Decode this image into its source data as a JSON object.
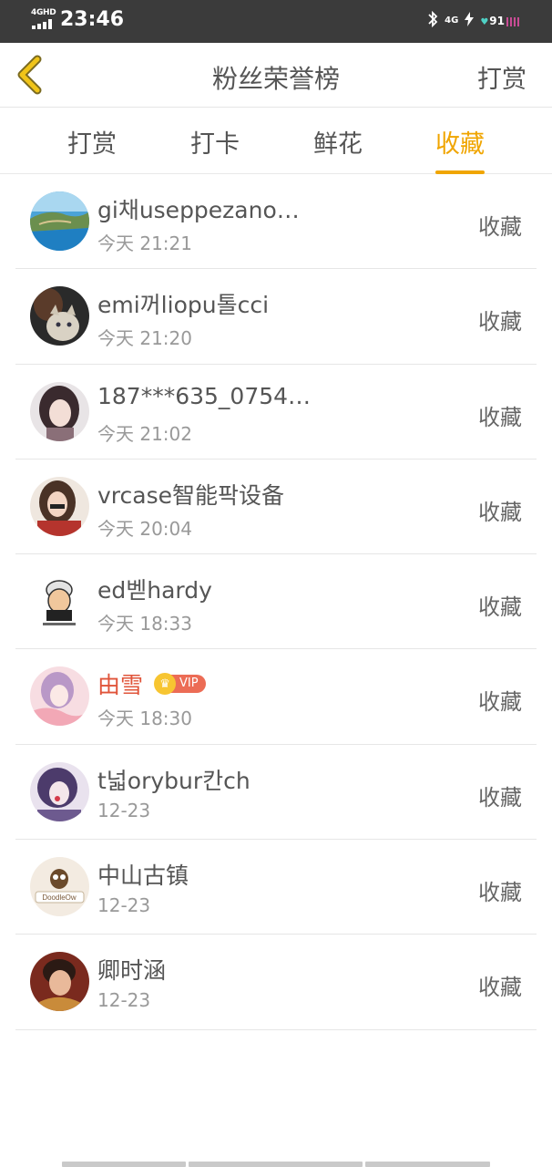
{
  "status_bar": {
    "network_label": "4GHD",
    "time": "23:46",
    "bluetooth_icon": "bluetooth-icon",
    "mobile_label": "4G",
    "battery_level": "91",
    "charging_icon": "lightning-icon"
  },
  "header": {
    "back_icon": "chevron-left-icon",
    "title": "粉丝荣誉榜",
    "action_label": "打赏"
  },
  "tabs": [
    {
      "label": "打赏",
      "active": false
    },
    {
      "label": "打卡",
      "active": false
    },
    {
      "label": "鲜花",
      "active": false
    },
    {
      "label": "收藏",
      "active": true
    }
  ],
  "colors": {
    "accent": "#f0a500",
    "vip_name": "#e0543a",
    "status_bar": "#3b3b3b"
  },
  "list": [
    {
      "name": "gi채useppezano…",
      "time": "今天 21:21",
      "action": "收藏",
      "vip": false,
      "avatar": "landscape-avatar"
    },
    {
      "name": "emi꺼liopu톨cci",
      "time": "今天 21:20",
      "action": "收藏",
      "vip": false,
      "avatar": "cat-avatar"
    },
    {
      "name": "187***635_0754…",
      "time": "今天 21:02",
      "action": "收藏",
      "vip": false,
      "avatar": "girl-avatar"
    },
    {
      "name": "vrcase智能팍设备",
      "time": "今天 20:04",
      "action": "收藏",
      "vip": false,
      "avatar": "woman-avatar"
    },
    {
      "name": "ed벧hardy",
      "time": "今天 18:33",
      "action": "收藏",
      "vip": false,
      "avatar": "cartoon-avatar"
    },
    {
      "name": "由雪",
      "time": "今天 18:30",
      "action": "收藏",
      "vip": true,
      "vip_label": "VIP",
      "avatar": "anime-avatar"
    },
    {
      "name": "t넓orybur칸ch",
      "time": "12-23",
      "action": "收藏",
      "vip": false,
      "avatar": "illustration-avatar"
    },
    {
      "name": "中山古镇",
      "time": "12-23",
      "action": "收藏",
      "vip": false,
      "avatar": "owl-logo-avatar"
    },
    {
      "name": "卿时涵",
      "time": "12-23",
      "action": "收藏",
      "vip": false,
      "avatar": "portrait-avatar"
    }
  ]
}
